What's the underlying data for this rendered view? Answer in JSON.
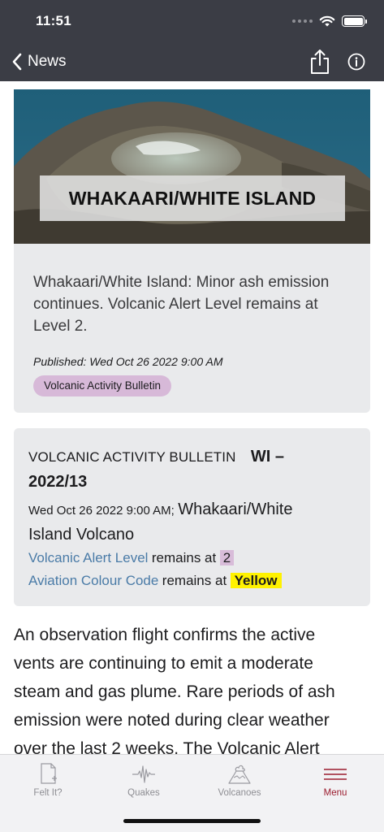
{
  "status_bar": {
    "time": "11:51"
  },
  "nav": {
    "back_label": "News"
  },
  "hero": {
    "title": "WHAKAARI/WHITE ISLAND"
  },
  "summary": {
    "title": "Whakaari/White Island: Minor ash emission continues. Volcanic Alert Level remains at Level 2.",
    "published": "Published: Wed Oct 26 2022 9:00 AM",
    "tag": "Volcanic Activity Bulletin"
  },
  "bulletin": {
    "heading": "VOLCANIC ACTIVITY BULLETIN",
    "code_part1": "WI –",
    "code_part2": "2022/13",
    "date": "Wed Oct 26 2022 9:00 AM;",
    "volcano_part1": "Whakaari/White",
    "volcano_part2": "Island Volcano",
    "alert_link": "Volcanic Alert Level",
    "alert_text": "remains at",
    "alert_level": "2",
    "aviation_link": "Aviation Colour Code",
    "aviation_text": "remains at",
    "aviation_code": "Yellow"
  },
  "body": {
    "lines": [
      "An observation flight confirms the active",
      "vents are continuing to emit a moderate",
      "steam and gas plume. Rare periods of ash",
      "emission were noted during clear weather",
      "over the last 2 weeks. The Volcanic Alert"
    ]
  },
  "tabs": [
    {
      "label": "Felt It?",
      "icon": "felt-it-icon",
      "active": false
    },
    {
      "label": "Quakes",
      "icon": "seismograph-icon",
      "active": false
    },
    {
      "label": "Volcanoes",
      "icon": "volcano-icon",
      "active": false
    },
    {
      "label": "Menu",
      "icon": "menu-icon",
      "active": true
    }
  ],
  "colors": {
    "header_bg": "#3b3d45",
    "card_bg": "#e9eaec",
    "link": "#4a7ba7",
    "tag_bg": "#d7b9d8",
    "aviation_yellow": "#fff200",
    "active_tab": "#9b1c2e"
  }
}
